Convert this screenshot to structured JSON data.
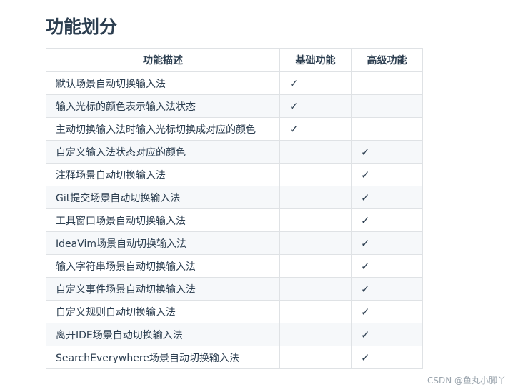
{
  "title": "功能划分",
  "table": {
    "headers": [
      "功能描述",
      "基础功能",
      "高级功能"
    ],
    "rows": [
      {
        "name": "默认场景自动切换输入法",
        "basic": "✓",
        "advanced": ""
      },
      {
        "name": "输入光标的颜色表示输入法状态",
        "basic": "✓",
        "advanced": ""
      },
      {
        "name": "主动切换输入法时输入光标切换成对应的颜色",
        "basic": "✓",
        "advanced": ""
      },
      {
        "name": "自定义输入法状态对应的颜色",
        "basic": "",
        "advanced": "✓"
      },
      {
        "name": "注释场景自动切换输入法",
        "basic": "",
        "advanced": "✓"
      },
      {
        "name": "Git提交场景自动切换输入法",
        "basic": "",
        "advanced": "✓"
      },
      {
        "name": "工具窗口场景自动切换输入法",
        "basic": "",
        "advanced": "✓"
      },
      {
        "name": "IdeaVim场景自动切换输入法",
        "basic": "",
        "advanced": "✓"
      },
      {
        "name": "输入字符串场景自动切换输入法",
        "basic": "",
        "advanced": "✓"
      },
      {
        "name": "自定义事件场景自动切换输入法",
        "basic": "",
        "advanced": "✓"
      },
      {
        "name": "自定义规则自动切换输入法",
        "basic": "",
        "advanced": "✓"
      },
      {
        "name": "离开IDE场景自动切换输入法",
        "basic": "",
        "advanced": "✓"
      },
      {
        "name": "SearchEverywhere场景自动切换输入法",
        "basic": "",
        "advanced": "✓"
      }
    ]
  },
  "watermark": "CSDN @鱼丸小脚丫"
}
